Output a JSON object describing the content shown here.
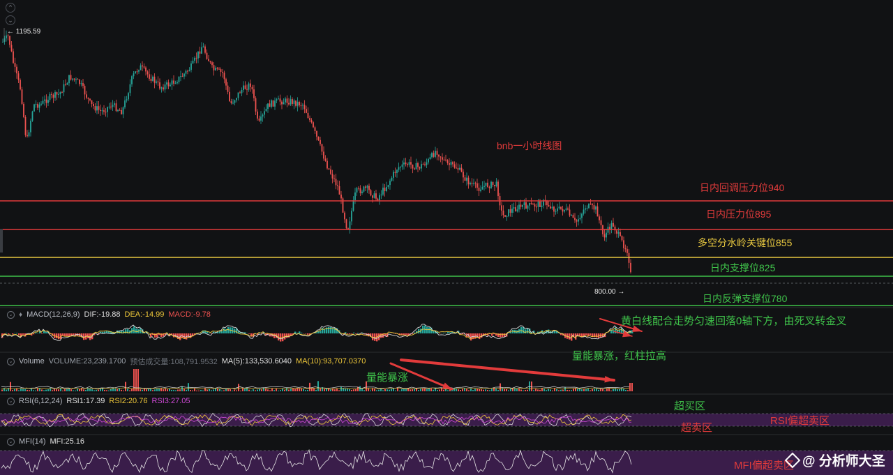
{
  "chart_title": "bnb一小时线图",
  "price": {
    "high_label": "1195.59",
    "low_label": "800.00"
  },
  "levels": [
    {
      "label": "日内回调压力位940",
      "color": "#e23b3b"
    },
    {
      "label": "日内压力位895",
      "color": "#e23b3b"
    },
    {
      "label": "多空分水岭关键位855",
      "color": "#e8c840"
    },
    {
      "label": "日内支撑位825",
      "color": "#3fc24a"
    },
    {
      "label": "日内反弹支撑位780",
      "color": "#3fc24a"
    }
  ],
  "macd": {
    "name": "MACD(12,26,9)",
    "dif": "DIF:-19.88",
    "dea": "DEA:-14.99",
    "macd": "MACD:-9.78",
    "annotation": "黄白线配合走势匀速回落0轴下方，由死叉转金叉"
  },
  "volume": {
    "name": "Volume",
    "volume": "VOLUME:23,239.1700",
    "estimate": "预估成交量:108,791.9532",
    "ma5": "MA(5):133,530.6040",
    "ma10": "MA(10):93,707.0370",
    "annotation_left": "量能暴涨",
    "annotation_right": "量能暴涨，红柱拉高"
  },
  "rsi": {
    "name": "RSI(6,12,24)",
    "rsi1": "RSI1:17.39",
    "rsi2": "RSI2:20.76",
    "rsi3": "RSI3:27.05",
    "overbought": "超买区",
    "oversold": "超卖区",
    "annotation": "RSI偏超卖区"
  },
  "mfi": {
    "name": "MFI(14)",
    "value": "MFI:25.16",
    "annotation": "MFI偏超卖区"
  },
  "watermark": "@ 分析师大圣",
  "colors": {
    "up": "#26a69a",
    "down": "#ef5350",
    "yellow": "#f0c93a",
    "white": "#d8d8d8",
    "purple_band": "#3a1d4a",
    "red_line": "#e23b3b",
    "green_line": "#3fc24a",
    "yellow_line": "#e8c840"
  },
  "icons": [
    "chevron-up-icon",
    "chevron-down-icon",
    "eye-icon",
    "bell-icon",
    "logo-icon"
  ]
}
